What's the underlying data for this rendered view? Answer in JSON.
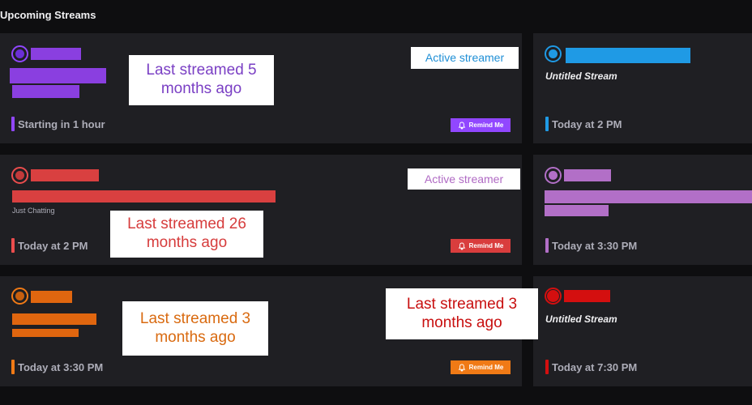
{
  "section_title": "Upcoming Streams",
  "remind_label": "Remind Me",
  "cards": {
    "purple_main": {
      "schedule": "Starting in 1 hour",
      "accent": "#9147ff"
    },
    "blue": {
      "title": "Untitled Stream",
      "schedule": "Today at 2 PM",
      "accent": "#1f9ae5"
    },
    "red": {
      "category": "Just Chatting",
      "schedule": "Today at 2 PM",
      "accent": "#eb4d4d"
    },
    "lavender": {
      "schedule": "Today at 3:30 PM",
      "accent": "#b26fc7"
    },
    "orange": {
      "schedule": "Today at 3:30 PM",
      "accent": "#f07a16"
    },
    "darkred": {
      "title": "Untitled Stream",
      "schedule": "Today at 7:30 PM",
      "accent": "#d40f0f"
    }
  },
  "notes": {
    "purple": "Last streamed 5\nmonths ago",
    "active_blue": "Active streamer",
    "active_lavender": "Active streamer",
    "red": "Last streamed 26\nmonths ago",
    "orange": "Last streamed 3\nmonths ago",
    "darkred": "Last streamed 3\nmonths ago"
  },
  "icons": [
    "bell-icon"
  ]
}
